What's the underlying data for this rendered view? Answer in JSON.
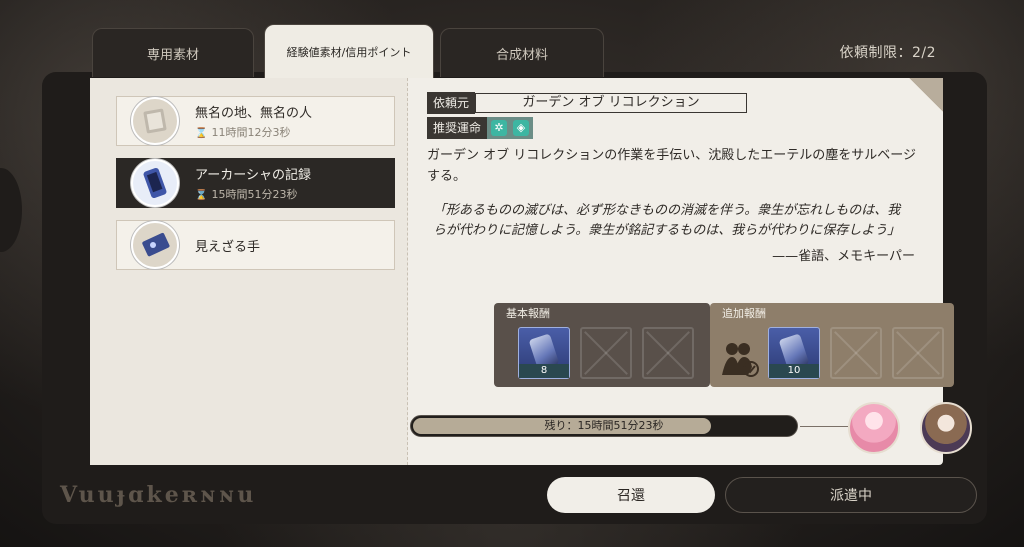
{
  "tabs": [
    {
      "label": "専用素材",
      "active": false
    },
    {
      "label": "経験値素材/信用ポイント",
      "active": true
    },
    {
      "label": "合成材料",
      "active": false
    }
  ],
  "quota": "依頼制限：2/2",
  "missions": [
    {
      "name": "無名の地、無名の人",
      "time": "11時間12分3秒",
      "active": false
    },
    {
      "name": "アーカーシャの記録",
      "time": "15時間51分23秒",
      "active": true
    },
    {
      "name": "見えざる手",
      "time": "",
      "active": false
    }
  ],
  "detail": {
    "client_label": "依頼元",
    "client_value": "ガーデン オブ リコレクション",
    "path_label": "推奨運命",
    "description": "ガーデン オブ リコレクションの作業を手伝い、沈殿したエーテルの塵をサルベージする。",
    "quote": "「形あるものの滅びは、必ず形なきものの消滅を伴う。衆生が忘れしものは、我らが代わりに記憶しよう。衆生が銘記するものは、我らが代わりに保存しよう」",
    "quote_author": "——雀語、メモキーパー"
  },
  "rewards": {
    "base_label": "基本報酬",
    "base_count": "8",
    "extra_label": "追加報酬",
    "extra_count": "10"
  },
  "progress": {
    "text": "残り：15時間51分23秒",
    "fraction": 0.78
  },
  "buttons": {
    "recall": "召還",
    "dispatch": "派遣中"
  },
  "colors": {
    "accent_teal": "#3db6a2",
    "paper": "#f1eee8",
    "frame": "#1f1c1a"
  }
}
